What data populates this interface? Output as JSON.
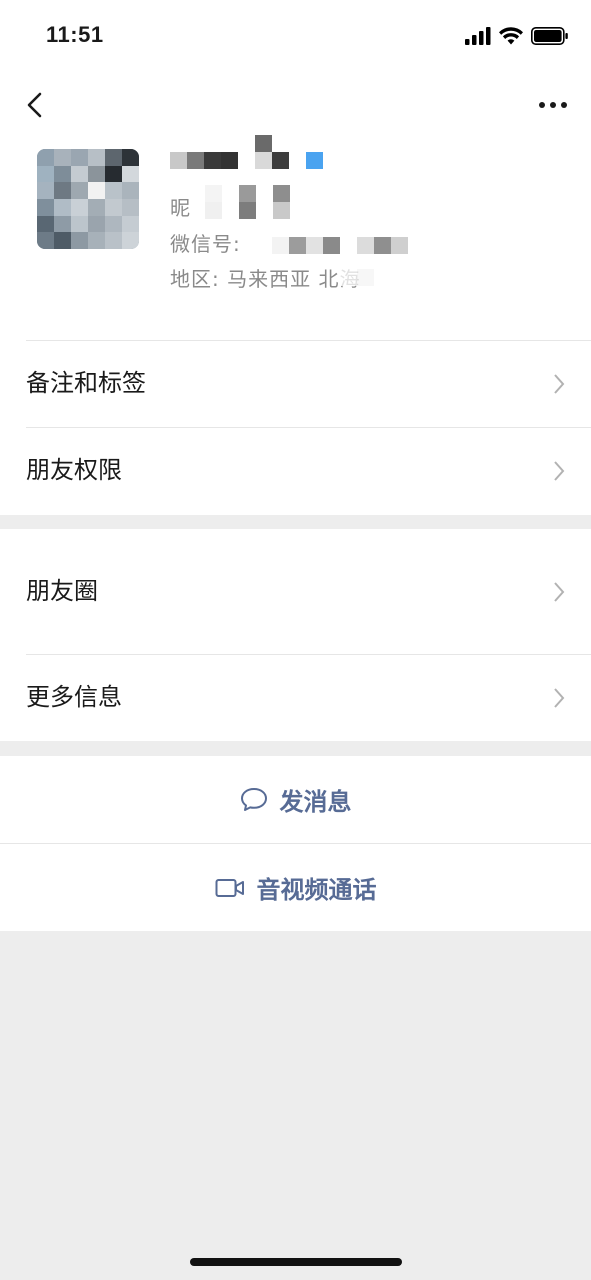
{
  "status_bar": {
    "time": "11:51"
  },
  "nav": {
    "back_icon": "chevron-left-icon",
    "more_icon": "ellipsis-icon"
  },
  "profile": {
    "nickname_prefix": "昵",
    "wechat_id_prefix": "微信号:",
    "region_prefix": "地区:",
    "region_value": "马来西亚 北海"
  },
  "menu_group_1": [
    {
      "label": "备注和标签"
    },
    {
      "label": "朋友权限"
    }
  ],
  "menu_group_2": [
    {
      "label": "朋友圈"
    },
    {
      "label": "更多信息"
    }
  ],
  "actions": {
    "send_message": "发消息",
    "video_call": "音视频通话"
  },
  "colors": {
    "link_blue": "#576b95",
    "background_gray": "#ededed",
    "chevron_gray": "#b2b2b2"
  }
}
